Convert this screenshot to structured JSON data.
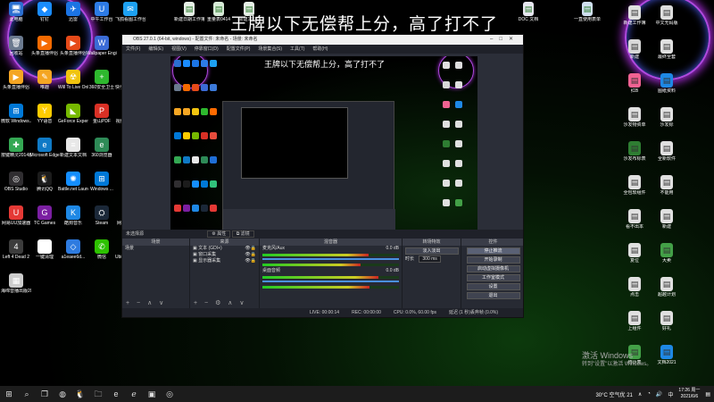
{
  "overlay_text": "王牌以下无偿帮上分，高了打不了",
  "left_icons": [
    {
      "label": "此电脑",
      "color": "#2b6fd1",
      "glyph": "🖥"
    },
    {
      "label": "钉钉",
      "color": "#1a8cff",
      "glyph": "◆"
    },
    {
      "label": "迅雷",
      "color": "#1b74e4",
      "glyph": "✈"
    },
    {
      "label": "中午工作台",
      "color": "#2d7be5",
      "glyph": "U"
    },
    {
      "label": "飞鸽看图工作台",
      "color": "#1da1f2",
      "glyph": "✉"
    },
    {
      "label": "回收站",
      "color": "#6b7a8f",
      "glyph": "🗑"
    },
    {
      "label": "头条直播伴侣",
      "color": "#f56a00",
      "glyph": "▶"
    },
    {
      "label": "头条直播伴侣",
      "color": "#e64a19",
      "glyph": "▶"
    },
    {
      "label": "Wallpaper Engine",
      "color": "#3b6bd6",
      "glyph": "W"
    },
    {
      "label": "控制面板",
      "color": "#3c7ad9",
      "glyph": "⚙"
    },
    {
      "label": "头条直播伴侣",
      "color": "#f5a623",
      "glyph": "▶"
    },
    {
      "label": "唯趣",
      "color": "#f5a623",
      "glyph": "✎"
    },
    {
      "label": "Will To Live Online",
      "color": "#f1c40f",
      "glyph": "☢"
    },
    {
      "label": "360安全卫士",
      "color": "#2eb82e",
      "glyph": "+"
    },
    {
      "label": "快手小店商家工作台",
      "color": "#ff6a00",
      "glyph": "◉"
    },
    {
      "label": "微软 Windows...",
      "color": "#0078d7",
      "glyph": "⊞"
    },
    {
      "label": "YY语音",
      "color": "#ffcc00",
      "glyph": "Y"
    },
    {
      "label": "GeForce Experience",
      "color": "#76b900",
      "glyph": "◣"
    },
    {
      "label": "金山PDF",
      "color": "#d93025",
      "glyph": "P"
    },
    {
      "label": "视频剪辑专家2",
      "color": "#e74c3c",
      "glyph": "▶"
    },
    {
      "label": "按键精灵2014版",
      "color": "#34a853",
      "glyph": "✚"
    },
    {
      "label": "Microsoft Edge",
      "color": "#0f7ac6",
      "glyph": "e"
    },
    {
      "label": "新建文本文档",
      "color": "#e8e8e8",
      "glyph": "≡"
    },
    {
      "label": "360浏览器",
      "color": "#2e8b57",
      "glyph": "e"
    },
    {
      "label": "此电脑",
      "color": "#1f6fd6",
      "glyph": "🖥"
    },
    {
      "label": "OBS Studio",
      "color": "#302e31",
      "glyph": "◎"
    },
    {
      "label": "腾讯QQ",
      "color": "#1c1c1c",
      "glyph": "🐧"
    },
    {
      "label": "Battle.net Launcher",
      "color": "#148eff",
      "glyph": "✺"
    },
    {
      "label": "Windows ...",
      "color": "#0078d7",
      "glyph": "⊞"
    },
    {
      "label": "QQ音乐",
      "color": "#31c27c",
      "glyph": "♪"
    },
    {
      "label": "网易UU加速器",
      "color": "#e53935",
      "glyph": "U"
    },
    {
      "label": "TC Games",
      "color": "#7b1fa2",
      "glyph": "G"
    },
    {
      "label": "酷狗音乐",
      "color": "#1e88e5",
      "glyph": "K"
    },
    {
      "label": "Steam",
      "color": "#1b2838",
      "glyph": "⛭"
    },
    {
      "label": "网易有道翻译",
      "color": "#e53935",
      "glyph": "有"
    },
    {
      "label": "Left 4 Dead 2",
      "color": "#3c3c3c",
      "glyph": "4"
    },
    {
      "label": "一键清理",
      "color": "#ffffff",
      "glyph": "◐"
    },
    {
      "label": "a1eaee6d...",
      "color": "#2e7be0",
      "glyph": "◇"
    },
    {
      "label": "微信",
      "color": "#2dc100",
      "glyph": "✆"
    },
    {
      "label": "Ubisoft Connect",
      "color": "#4a90e2",
      "glyph": "◎"
    },
    {
      "label": "海绵音播出版2010(1)",
      "color": "#cccccc",
      "glyph": "▦"
    }
  ],
  "top_files": [
    {
      "label": "新建日期工作簿20210727",
      "color": "#e7f0e7"
    },
    {
      "label": "重量表0414",
      "color": "#d8ebd8"
    },
    {
      "label": "新建1数据",
      "color": "#e7f0e7"
    },
    {
      "label": "DOC 文档",
      "color": "#e7e7f0"
    },
    {
      "label": "一直使用表单",
      "color": "#d0e0f0"
    }
  ],
  "right_icons": [
    {
      "label": "新建工作簿",
      "color": "#e0e0e0"
    },
    {
      "label": "中文无码版",
      "color": "#dddddd"
    },
    {
      "label": "新建",
      "color": "#d8d8d8"
    },
    {
      "label": "最终全套",
      "color": "#e0e0e0"
    },
    {
      "label": "红B",
      "color": "#f06292"
    },
    {
      "label": "图纸资料",
      "color": "#1e88e5"
    },
    {
      "label": "沙发物资单",
      "color": "#e0e0e0"
    },
    {
      "label": "沙发标",
      "color": "#e0e0e0"
    },
    {
      "label": "沙发布标表",
      "color": "#2e7d32"
    },
    {
      "label": "全新软件",
      "color": "#e0e0e0"
    },
    {
      "label": "全包软组件",
      "color": "#e0e0e0"
    },
    {
      "label": "不能用",
      "color": "#e0e0e0"
    },
    {
      "label": "看不出本",
      "color": "#e0e0e0"
    },
    {
      "label": "新建",
      "color": "#e0e0e0"
    },
    {
      "label": "复位",
      "color": "#e0e0e0"
    },
    {
      "label": "大卖",
      "color": "#43a047"
    },
    {
      "label": "点击",
      "color": "#e0e0e0"
    },
    {
      "label": "超越计划",
      "color": "#e0e0e0"
    },
    {
      "label": "上组件",
      "color": "#e0e0e0"
    },
    {
      "label": "好礼",
      "color": "#e0e0e0"
    },
    {
      "label": "统计表",
      "color": "#43a047"
    },
    {
      "label": "文档2021",
      "color": "#1e88e5"
    }
  ],
  "obs": {
    "title": "OBS 27.0.1 (64-bit, windows) - 配置文件: 未命名 - 场景: 未命名",
    "menu": [
      "文件(F)",
      "编辑(E)",
      "视图(V)",
      "停靠窗口(D)",
      "配置文件(P)",
      "场景集合(S)",
      "工具(T)",
      "帮助(H)"
    ],
    "no_source_selected": "未选择源",
    "props_label": "属性",
    "filters_label": "滤镜",
    "docks": {
      "scenes": {
        "header": "场景",
        "items": [
          "场景"
        ]
      },
      "sources": {
        "header": "来源",
        "items": [
          "文本 (GDI+)",
          "窗口采集",
          "显示器采集"
        ]
      },
      "mixer": {
        "header": "混音器",
        "tracks": [
          {
            "name": "麦克风/Aux",
            "db": "0.0 dB",
            "level": 0.78
          },
          {
            "name": "桌面音频",
            "db": "0.0 dB",
            "level": 0.85
          }
        ]
      },
      "transitions": {
        "header": "转场特效",
        "type": "淡入淡出",
        "duration_label": "时长",
        "duration": "300 ms"
      },
      "controls": {
        "header": "控件",
        "buttons": [
          "停止推流",
          "开始录制",
          "启动虚拟摄像机",
          "工作室模式",
          "设置",
          "退出"
        ]
      }
    },
    "status": [
      "LIVE: 00:00:14",
      "REC: 00:00:00",
      "CPU: 0.0%, 60.00 fps",
      "延迟 (1 秒)丢弃帧 (0.0%)"
    ]
  },
  "watermark": {
    "line1": "激活 Windows",
    "line2": "转到\"设置\"以激活 Windows。"
  },
  "taskbar": {
    "icons": [
      "start-icon",
      "search-icon",
      "taskview-icon",
      "chrome-icon",
      "qq-icon",
      "files-icon",
      "edge-icon",
      "ie-icon",
      "photos-icon",
      "obs-icon"
    ],
    "weather": "30°C 空气优 21",
    "time": "17:26 周一",
    "date": "2021/6/6",
    "lang": "中"
  }
}
